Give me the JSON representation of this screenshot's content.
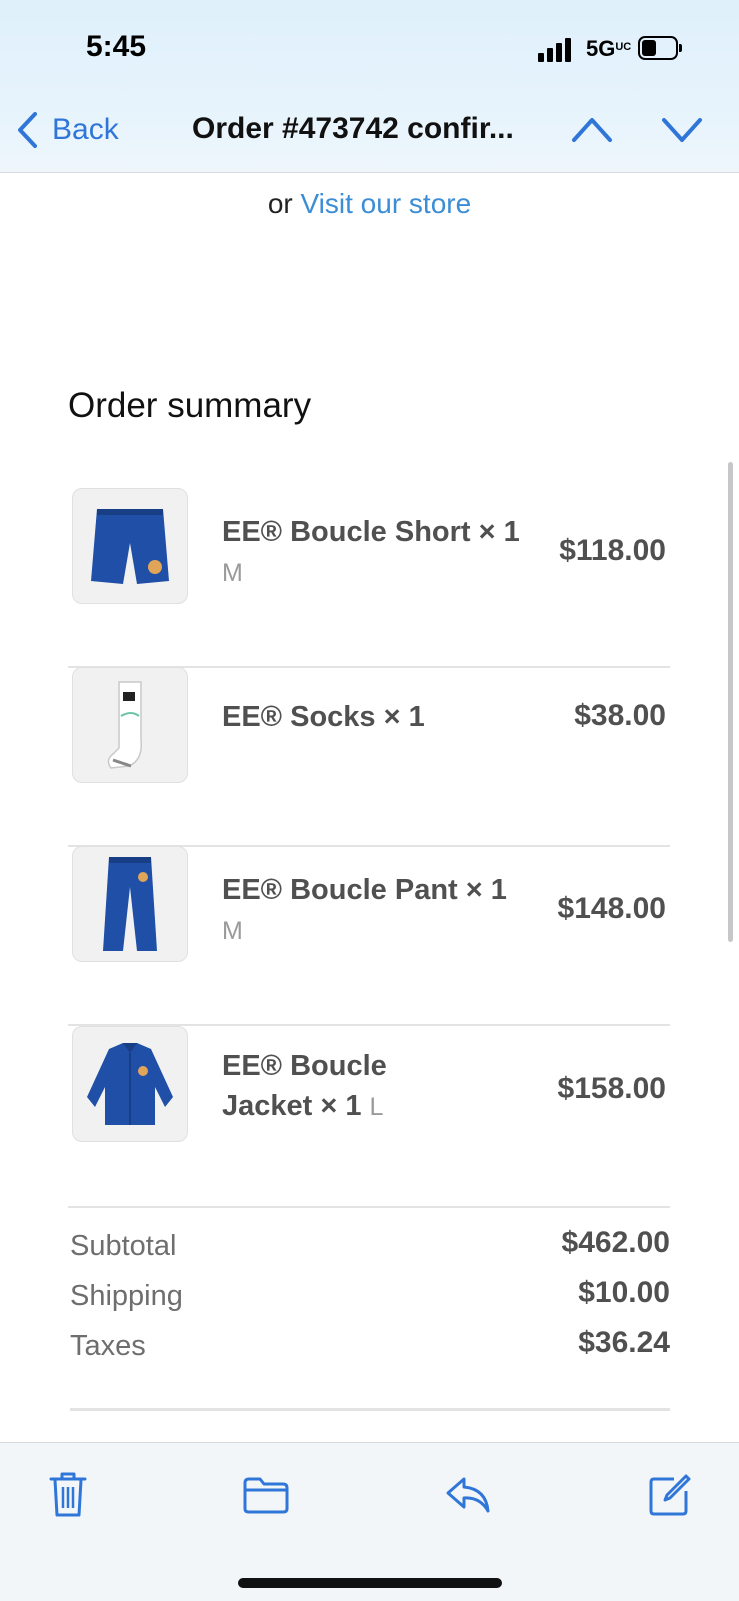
{
  "status_bar": {
    "time": "5:45",
    "network": "5G",
    "network_suffix": "UC"
  },
  "header": {
    "back_label": "Back",
    "subject": "Order #473742 confir..."
  },
  "content": {
    "visit_prefix": "or",
    "visit_link": "Visit our store",
    "summary_title": "Order summary",
    "items": [
      {
        "name": "EE® Boucle Short × 1",
        "variant": "M",
        "price": "$118.00",
        "icon": "blue-shorts-image"
      },
      {
        "name": "EE® Socks × 1",
        "variant": "",
        "price": "$38.00",
        "icon": "white-socks-image"
      },
      {
        "name": "EE® Boucle Pant × 1",
        "variant": "M",
        "price": "$148.00",
        "icon": "blue-pants-image"
      },
      {
        "name_line1": "EE® Boucle",
        "name_line2": "Jacket × 1",
        "variant": "L",
        "price": "$158.00",
        "icon": "blue-jacket-image"
      }
    ],
    "totals": [
      {
        "label": "Subtotal",
        "value": "$462.00"
      },
      {
        "label": "Shipping",
        "value": "$10.00"
      },
      {
        "label": "Taxes",
        "value": "$36.24"
      }
    ]
  },
  "toolbar": {
    "icons": [
      "trash-icon",
      "folder-icon",
      "reply-icon",
      "compose-icon"
    ]
  },
  "colors": {
    "accent": "#2f76d8",
    "link": "#3b8dd6",
    "product_blue": "#1f4fa6"
  }
}
